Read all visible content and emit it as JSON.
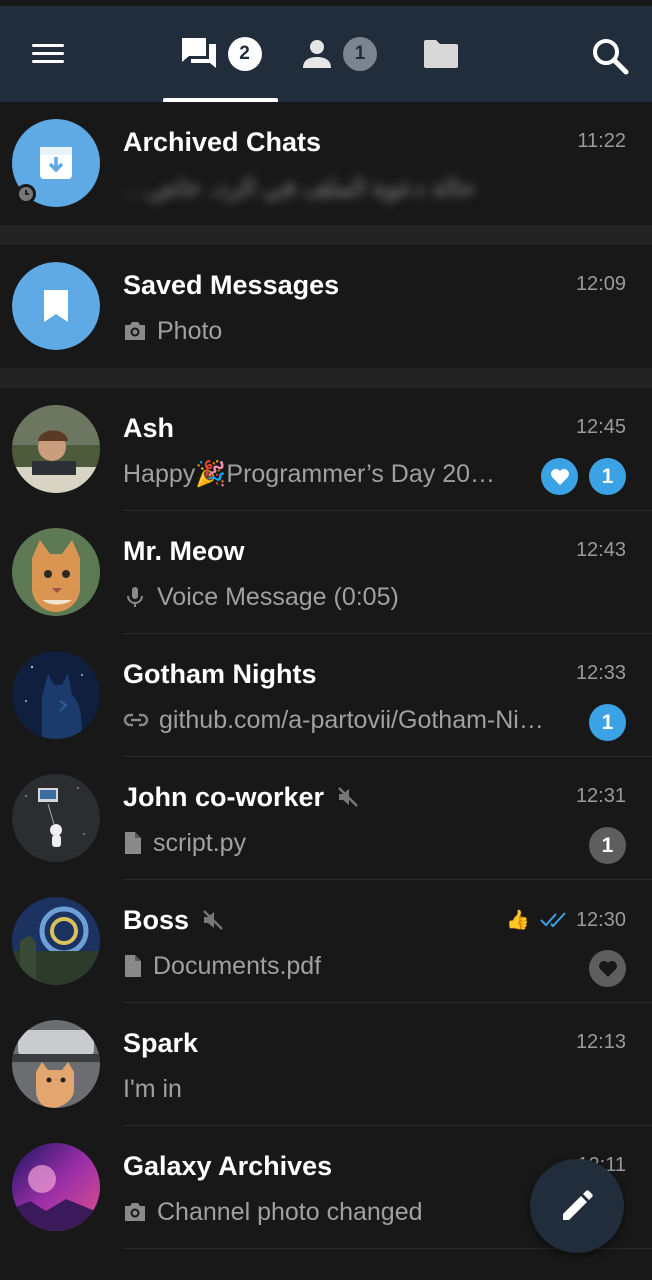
{
  "header": {
    "tabs": [
      {
        "name": "chats",
        "badge": "2",
        "icon": "chats-icon"
      },
      {
        "name": "contacts",
        "badge": "1",
        "icon": "contact-icon"
      },
      {
        "name": "folders",
        "icon": "folder-icon"
      }
    ]
  },
  "chats": [
    {
      "name": "Archived Chats",
      "time": "11:22",
      "preview": "…حالة دعوة الملف في الرد، خاص",
      "blurred": true,
      "icon": "archive-icon"
    },
    {
      "name": "Saved Messages",
      "time": "12:09",
      "preview": "Photo",
      "icon": "bookmark-icon"
    },
    {
      "name": "Ash",
      "time": "12:45",
      "preview": "Happy🎉Programmer’s Day 20…",
      "reaction": "heart",
      "unread": "1"
    },
    {
      "name": "Mr. Meow",
      "time": "12:43",
      "preview": "Voice Message (0:05)"
    },
    {
      "name": "Gotham Nights",
      "time": "12:33",
      "preview": "github.com/a-partovii/Gotham-Ni…",
      "unread": "1"
    },
    {
      "name": "John co-worker",
      "time": "12:31",
      "preview": "script.py",
      "muted": true,
      "unread": "1"
    },
    {
      "name": "Boss",
      "time": "12:30",
      "preview": "Documents.pdf",
      "muted": true,
      "reaction_sent": "👍",
      "read": true
    },
    {
      "name": "Spark",
      "time": "12:13",
      "preview": "I'm in"
    },
    {
      "name": "Galaxy Archives",
      "time": "12:11",
      "preview": "Channel photo changed"
    }
  ],
  "colors": {
    "header": "#212d3b",
    "background": "#181818",
    "accent": "#3ca2e6",
    "muted_badge": "#5e5e5e"
  }
}
